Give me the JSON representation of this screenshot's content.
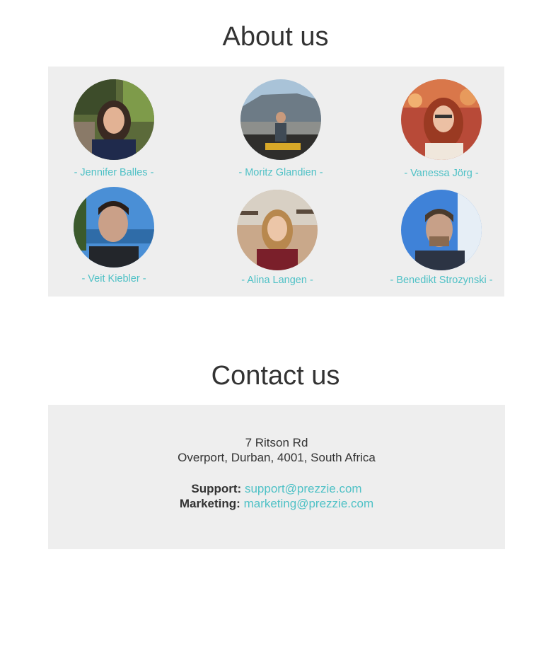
{
  "about": {
    "title": "About us",
    "members": [
      {
        "name": "- Jennifer Balles -"
      },
      {
        "name": "- Moritz Glandien -"
      },
      {
        "name": "- Vanessa Jörg -"
      },
      {
        "name": "- Veit Kiebler -"
      },
      {
        "name": "- Alina Langen -"
      },
      {
        "name": "- Benedikt Strozynski -"
      }
    ]
  },
  "contact": {
    "title": "Contact us",
    "address_line1": "7 Ritson Rd",
    "address_line2": "Overport, Durban, 4001, South Africa",
    "support_label": "Support:",
    "support_email": "support@prezzie.com",
    "marketing_label": "Marketing:",
    "marketing_email": "marketing@prezzie.com"
  },
  "colors": {
    "accent": "#4fc1c6",
    "panel_bg": "#eeeeee",
    "text": "#333333"
  }
}
